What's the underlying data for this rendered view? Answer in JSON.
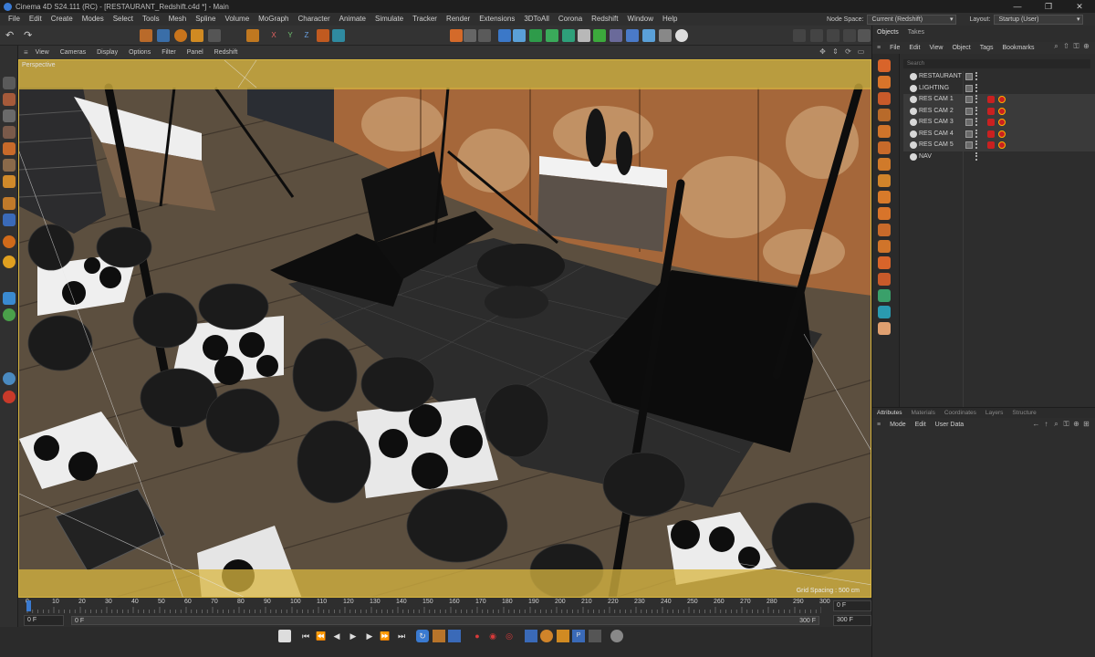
{
  "titlebar": {
    "title": "Cinema 4D S24.111 (RC) - [RESTAURANT_Redshift.c4d *] - Main",
    "minimize": "—",
    "maximize": "❐",
    "close": "✕"
  },
  "menubar": [
    "File",
    "Edit",
    "Create",
    "Modes",
    "Select",
    "Tools",
    "Mesh",
    "Spline",
    "Volume",
    "MoGraph",
    "Character",
    "Animate",
    "Simulate",
    "Tracker",
    "Render",
    "Extensions",
    "3DToAll",
    "Corona",
    "Redshift",
    "Window",
    "Help"
  ],
  "nodespace": {
    "label": "Node Space:",
    "value": "Current (Redshift)"
  },
  "layout": {
    "label": "Layout:",
    "value": "Startup (User)"
  },
  "viewport": {
    "menu": [
      "View",
      "Cameras",
      "Display",
      "Options",
      "Filter",
      "Panel",
      "Redshift"
    ],
    "perspective_label": "Perspective",
    "grid_spacing": "Grid Spacing : 500 cm"
  },
  "timeline": {
    "ticks": [
      "0",
      "10",
      "20",
      "30",
      "40",
      "50",
      "60",
      "70",
      "80",
      "90",
      "100",
      "110",
      "120",
      "130",
      "140",
      "150",
      "160",
      "170",
      "180",
      "190",
      "200",
      "210",
      "220",
      "230",
      "240",
      "250",
      "260",
      "270",
      "280",
      "290",
      "300"
    ],
    "current_frame": "0 F",
    "start": "0 F",
    "range_start": "0 F",
    "range_end": "300 F",
    "end": "300 F"
  },
  "objects_panel": {
    "tabs": [
      "Objects",
      "Takes"
    ],
    "menu": [
      "File",
      "Edit",
      "View",
      "Object",
      "Tags",
      "Bookmarks"
    ],
    "search_placeholder": "Search",
    "items": [
      {
        "name": "RESTAURANT",
        "tags": false
      },
      {
        "name": "LIGHTING",
        "tags": false
      },
      {
        "name": "RES CAM 1",
        "tags": true
      },
      {
        "name": "RES CAM 2",
        "tags": true
      },
      {
        "name": "RES CAM 3",
        "tags": true
      },
      {
        "name": "RES CAM 4",
        "tags": true
      },
      {
        "name": "RES CAM 5",
        "tags": true
      },
      {
        "name": "NAV",
        "tags": false
      }
    ]
  },
  "attributes_panel": {
    "tabs": [
      "Attributes",
      "Materials",
      "Coordinates",
      "Layers",
      "Structure"
    ],
    "menu": [
      "Mode",
      "Edit",
      "User Data"
    ]
  },
  "colors": {
    "accent_yellow": "#d8b640",
    "tag_red": "#c92020",
    "ui_dark": "#2b2b2b"
  }
}
